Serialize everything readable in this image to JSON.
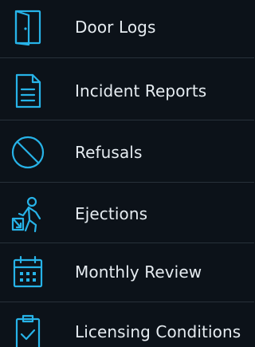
{
  "menu": {
    "accent_color": "#27b3e8",
    "background_color": "#0c1219",
    "items": [
      {
        "label": "Door Logs",
        "icon": "door-icon"
      },
      {
        "label": "Incident Reports",
        "icon": "document-icon"
      },
      {
        "label": "Refusals",
        "icon": "prohibited-icon"
      },
      {
        "label": "Ejections",
        "icon": "ejection-person-icon"
      },
      {
        "label": "Monthly Review",
        "icon": "calendar-icon"
      },
      {
        "label": "Licensing Conditions",
        "icon": "clipboard-check-icon"
      }
    ]
  }
}
